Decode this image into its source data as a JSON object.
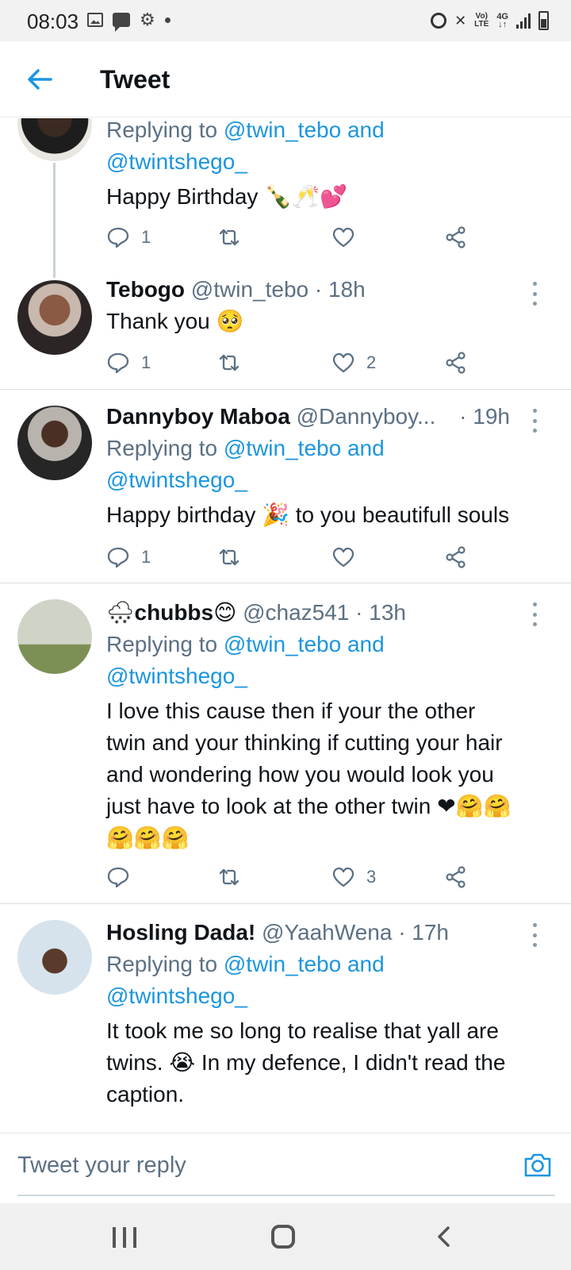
{
  "status_bar": {
    "time": "08:03",
    "network_top": "Vo)",
    "network_bottom": "LTE",
    "gen_top": "4G",
    "gen_bottom": "↓↑"
  },
  "header": {
    "title": "Tweet"
  },
  "tweets": [
    {
      "reply_prefix": "Replying to",
      "reply_handles": "@twin_tebo and",
      "reply_handles_2": "@twintshego_",
      "text": "Happy Birthday",
      "text_emoji": "🍾🥂💕",
      "reply_count": "1",
      "retweet_count": "",
      "like_count": ""
    },
    {
      "name": "Tebogo",
      "handle": "@twin_tebo",
      "time": "· 18h",
      "text": "Thank you",
      "text_emoji": "🥺",
      "reply_count": "1",
      "retweet_count": "",
      "like_count": "2"
    },
    {
      "name": "Dannyboy Maboa",
      "handle": "@Dannyboy...",
      "time": "· 19h",
      "reply_prefix": "Replying to",
      "reply_handles": "@twin_tebo and",
      "reply_handles_2": "@twintshego_",
      "text_before": "Happy birthday",
      "text_emoji": "🎉",
      "text_after": "to you beautifull souls",
      "reply_count": "1",
      "retweet_count": "",
      "like_count": ""
    },
    {
      "name_emoji_before": "🌨",
      "name": "chubbs",
      "name_emoji_after": "😊",
      "handle": "@chaz541",
      "time": "· 13h",
      "reply_prefix": "Replying to",
      "reply_handles": "@twin_tebo and",
      "reply_handles_2": "@twintshego_",
      "text_line_1": "I love this cause then if your the other",
      "text_line_2": "twin and your thinking if cutting your hair",
      "text_line_3": "and wondering how you would look you",
      "text_line_4": "just have to look at the other twin",
      "text_emoji_line_4": "❤🤗🤗",
      "text_emoji_line_5": "🤗🤗🤗",
      "reply_count": "",
      "retweet_count": "",
      "like_count": "3"
    },
    {
      "name": "Hosling Dada!",
      "handle": "@YaahWena",
      "time": "· 17h",
      "reply_prefix": "Replying to",
      "reply_handles": "@twin_tebo and",
      "reply_handles_2": "@twintshego_",
      "text_line_1": "It took me so long to realise that yall are",
      "text_line_2_before": "twins.",
      "text_line_2_emoji": "😭",
      "text_line_2_after": "In my defence, I didn't read the",
      "text_line_3": "caption."
    }
  ],
  "reply_bar": {
    "placeholder": "Tweet your reply"
  },
  "colors": {
    "accent": "#1b95e0",
    "muted": "#5b7083",
    "text": "#0f1419"
  }
}
